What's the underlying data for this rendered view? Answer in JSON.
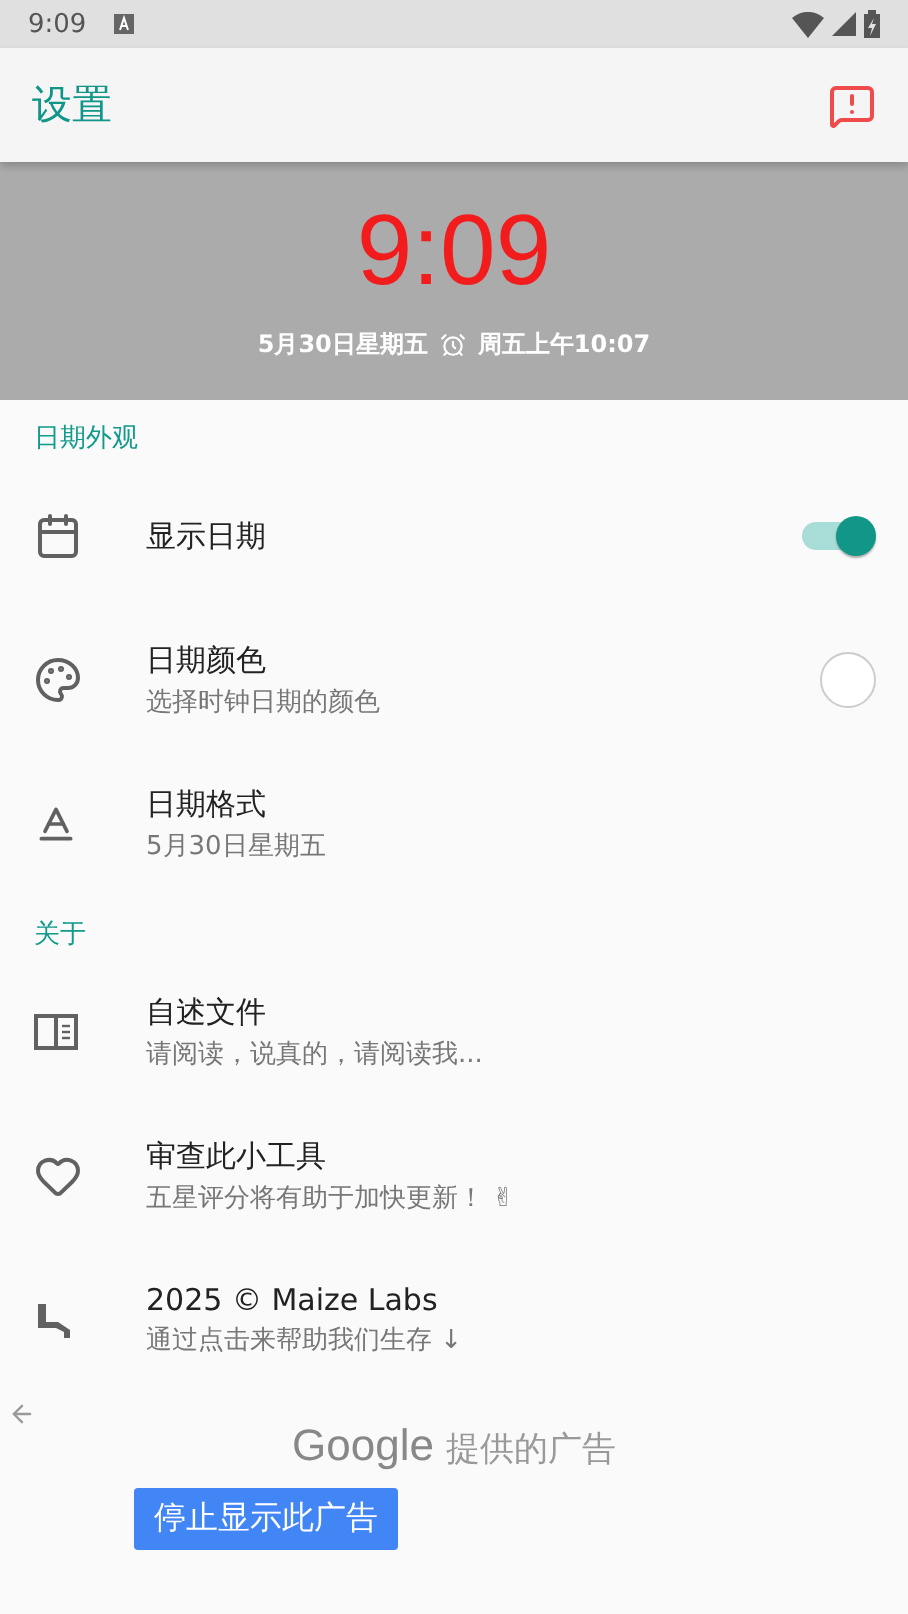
{
  "status_bar": {
    "time": "9:09"
  },
  "app_bar": {
    "title": "设置"
  },
  "clock": {
    "time": "9:09",
    "date": "5月30日星期五",
    "alarm": "周五上午10:07"
  },
  "sections": [
    {
      "title": "日期外观",
      "items": [
        {
          "kind": "toggle",
          "title": "显示日期",
          "on": true
        },
        {
          "kind": "swatch",
          "title": "日期颜色",
          "subtitle": "选择时钟日期的颜色",
          "color": "#ffffff"
        },
        {
          "kind": "plain",
          "title": "日期格式",
          "subtitle": "5月30日星期五"
        }
      ]
    },
    {
      "title": "关于",
      "items": [
        {
          "kind": "plain",
          "title": "自述文件",
          "subtitle": "请阅读，说真的，请阅读我..."
        },
        {
          "kind": "plain",
          "title": "审查此小工具",
          "subtitle": "五星评分将有助于加快更新！ ✌"
        },
        {
          "kind": "plain",
          "title": "2025 © Maize Labs",
          "subtitle": "通过点击来帮助我们生存 ↓"
        }
      ]
    }
  ],
  "ad": {
    "brand": "Google",
    "label": "提供的广告",
    "button": "停止显示此广告"
  }
}
